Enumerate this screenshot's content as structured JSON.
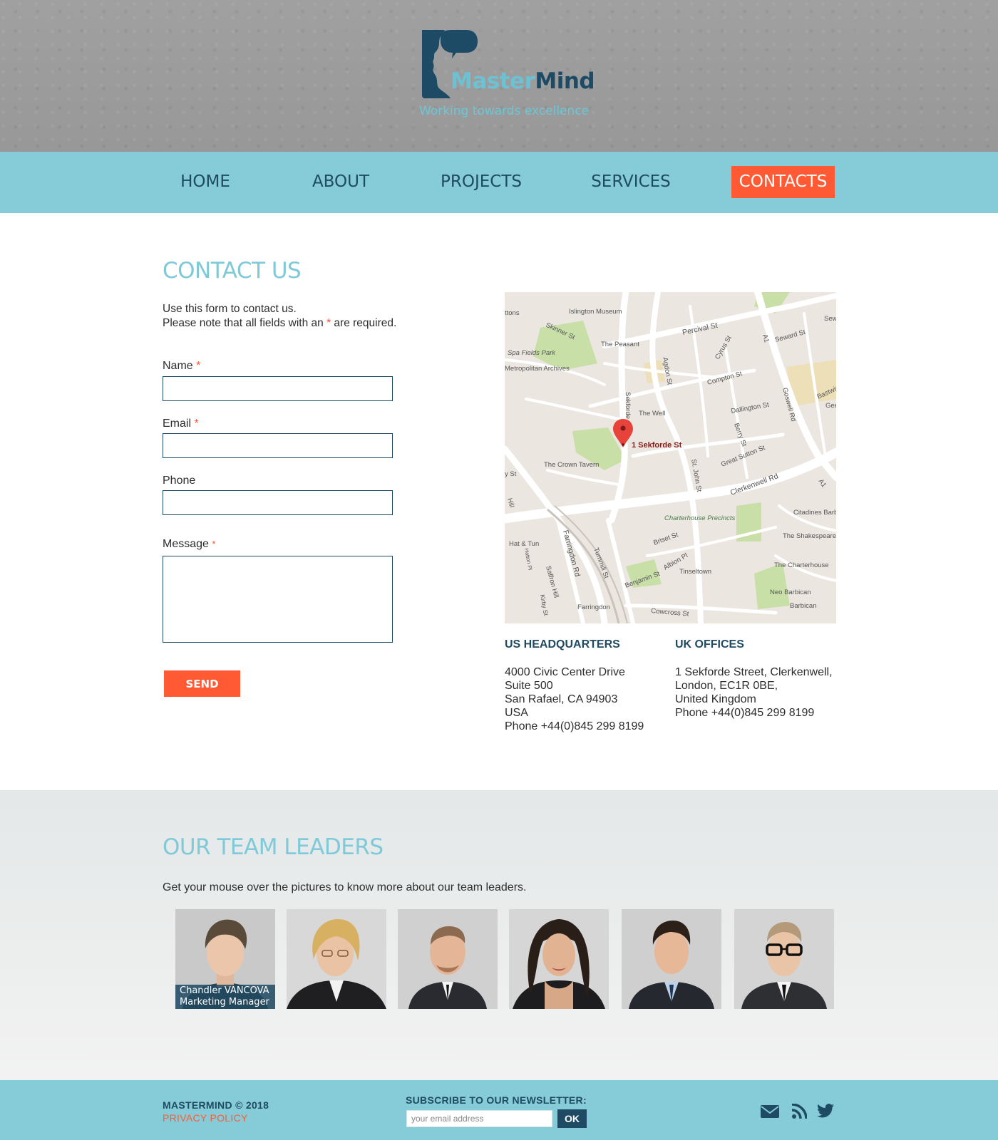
{
  "brand": {
    "name_part1": "Master",
    "name_part2": "Mind",
    "tagline": "Working towards excellence"
  },
  "nav": {
    "items": [
      {
        "label": "HOME"
      },
      {
        "label": "ABOUT"
      },
      {
        "label": "PROJECTS"
      },
      {
        "label": "SERVICES"
      },
      {
        "label": "CONTACTS",
        "active": true
      }
    ]
  },
  "contact": {
    "title": "CONTACT US",
    "intro_line1": "Use this form to contact us.",
    "intro_line2_prefix": "Please note that all fields with an",
    "required_mark": "*",
    "intro_line2_suffix": "are required.",
    "fields": {
      "name": {
        "label": "Name",
        "value": ""
      },
      "email": {
        "label": "Email",
        "value": ""
      },
      "phone": {
        "label": "Phone",
        "value": ""
      },
      "message": {
        "label": "Message",
        "value": ""
      }
    },
    "send_label": "SEND"
  },
  "map": {
    "pin_label": "1 Sekforde St",
    "labels": [
      "Islington Museum",
      "Skinner St",
      "Percival St",
      "Seward St",
      "The Peasant",
      "Spa Fields Park",
      "Metropolitan Archives",
      "Agdon St",
      "Cyrus St",
      "Compton St",
      "Sekforde St",
      "The Well",
      "Dallington St",
      "Goswell Rd",
      "Berry St",
      "The Crown Tavern",
      "Great Sutton St",
      "St. John St",
      "Clerkenwell Rd",
      "Citadines Barbican London",
      "Charterhouse Precincts",
      "The Shakespeare",
      "Hat & Tun",
      "Farringdon Rd",
      "Briset St",
      "Turnmill St",
      "Albion Pl",
      "Tinseltown",
      "The Charterhouse",
      "Saffron Hill",
      "Benjamin St",
      "Neo Barbican",
      "Barbican",
      "Farringdon",
      "Cowcross St",
      "Kirby St",
      "Hatton Pl",
      "A1",
      "Bastwick",
      "Gee",
      "ttons",
      "y St",
      "Hill",
      "Sew"
    ]
  },
  "offices": [
    {
      "title": "US HEADQUARTERS",
      "lines": [
        "4000 Civic Center Drive",
        "Suite 500",
        "San Rafael, CA 94903",
        "USA",
        "Phone +44(0)845 299 8199"
      ]
    },
    {
      "title": "UK OFFICES",
      "lines": [
        "1 Sekforde Street, Clerkenwell,",
        "London, EC1R 0BE,",
        "United Kingdom",
        "Phone +44(0)845 299 8199"
      ]
    }
  ],
  "team": {
    "title": "OUR TEAM LEADERS",
    "intro": "Get your mouse over the pictures to know more about our team leaders.",
    "hovered_member": {
      "name": "Chandler VANCOVA",
      "role": "Marketing Manager"
    },
    "photo_count": 6
  },
  "footer": {
    "copyright": "MASTERMIND © 2018",
    "privacy": "PRIVACY POLICY",
    "newsletter_title": "SUBSCRIBE TO OUR NEWSLETTER:",
    "email_placeholder": "your email address",
    "ok_label": "OK",
    "icons": [
      "mail-icon",
      "rss-icon",
      "twitter-icon"
    ]
  },
  "colors": {
    "accent": "#ff5a34",
    "nav_bg": "#86ccd8",
    "dark_blue": "#1e4a63",
    "heading_blue": "#7fc9d8"
  }
}
